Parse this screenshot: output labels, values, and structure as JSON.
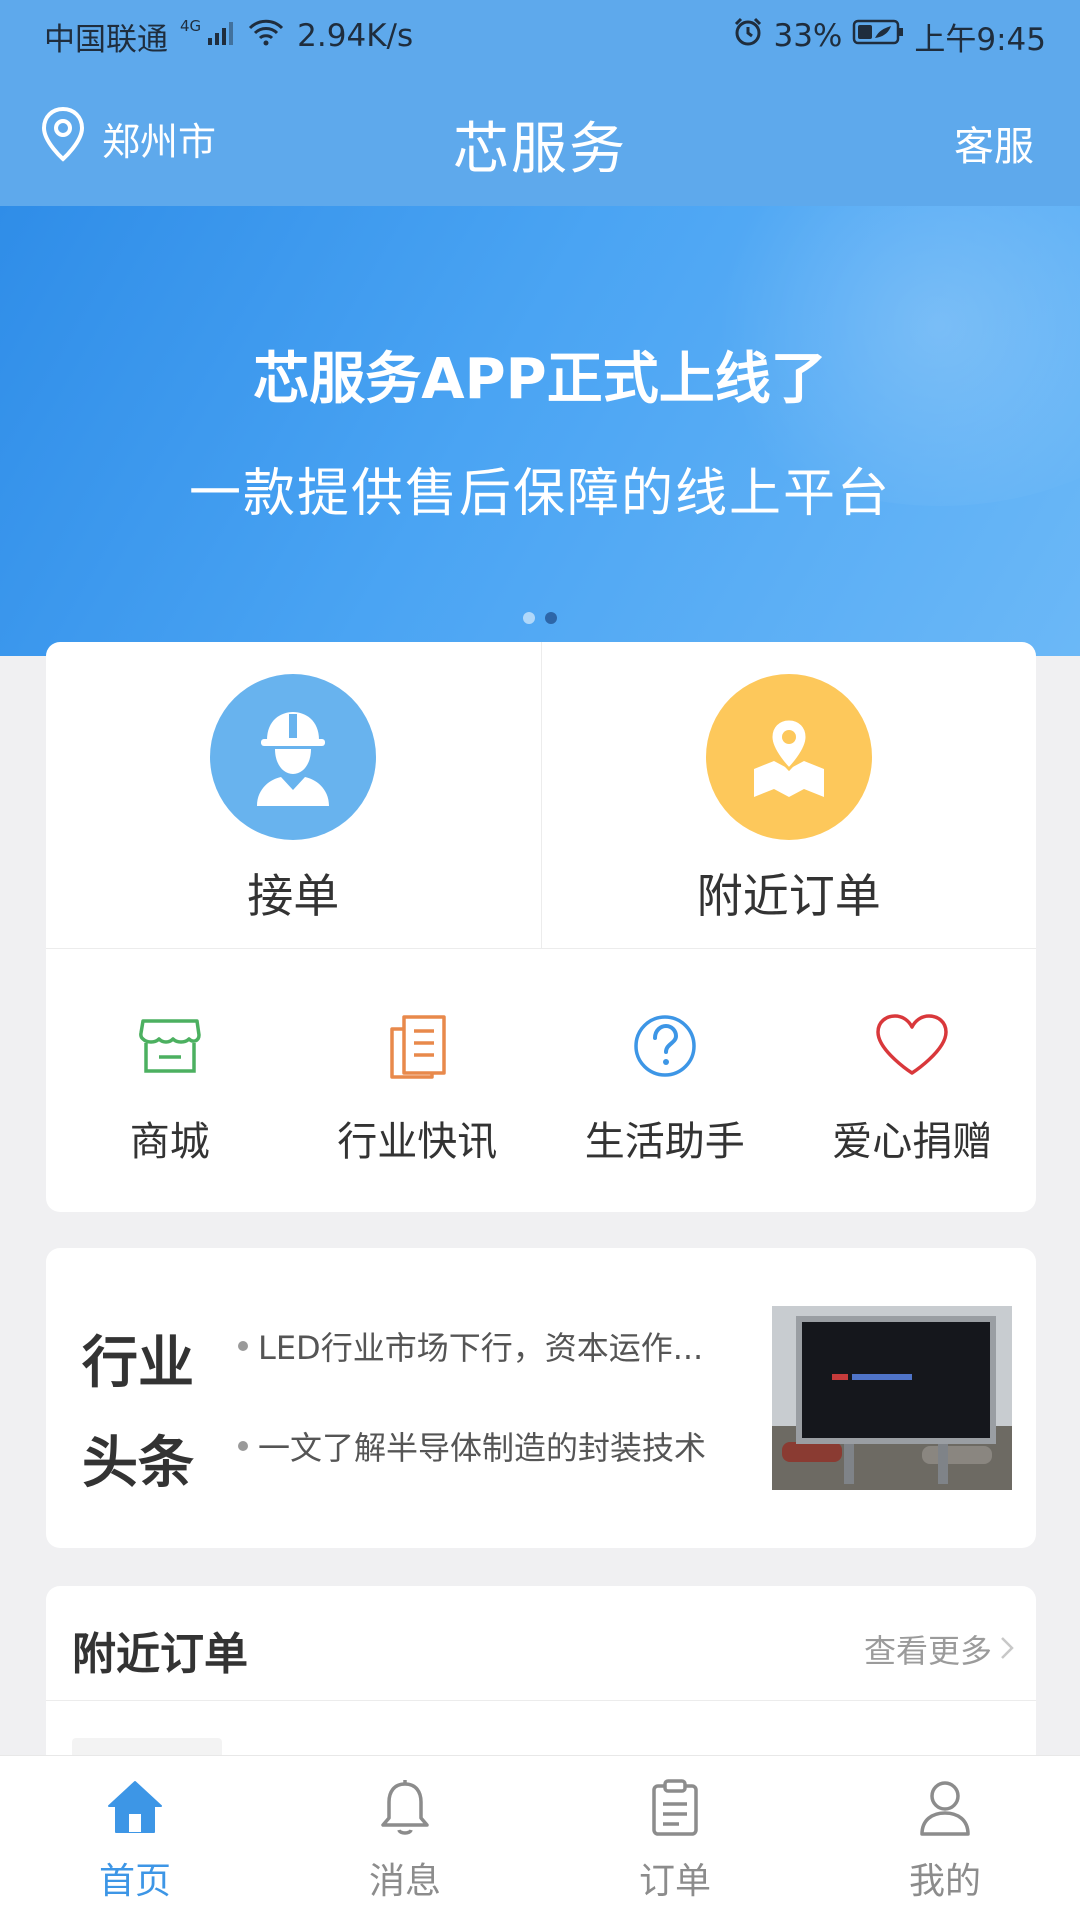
{
  "status_bar": {
    "carrier": "中国联通",
    "network_type": "4G",
    "network_speed": "2.94K/s",
    "battery": "33%",
    "time": "上午9:45",
    "icons": [
      "signal-icon",
      "wifi-icon",
      "alarm-icon",
      "battery-icon"
    ]
  },
  "header": {
    "location": "郑州市",
    "title": "芯服务",
    "service": "客服"
  },
  "banner": {
    "title": "芯服务APP正式上线了",
    "subtitle": "一款提供售后保障的线上平台",
    "page_count": 2,
    "active_page": 2
  },
  "actions": {
    "primary": [
      {
        "label": "接单",
        "icon": "worker-icon",
        "color": "#68b3ee"
      },
      {
        "label": "附近订单",
        "icon": "map-pin-icon",
        "color": "#fdc85b"
      }
    ],
    "secondary": [
      {
        "label": "商城",
        "icon": "store-icon",
        "color": "#4cb060"
      },
      {
        "label": "行业快讯",
        "icon": "news-icon",
        "color": "#e8894b"
      },
      {
        "label": "生活助手",
        "icon": "help-icon",
        "color": "#3d96e6"
      },
      {
        "label": "爱心捐赠",
        "icon": "heart-icon",
        "color": "#d9383b"
      }
    ]
  },
  "headlines": {
    "badge_line1": "行业",
    "badge_line2": "头条",
    "items": [
      "LED行业市场下行，资本运作...",
      "一文了解半导体制造的封装技术"
    ]
  },
  "nearby_orders": {
    "title": "附近订单",
    "more": "查看更多"
  },
  "bottom_nav": {
    "items": [
      {
        "label": "首页",
        "icon": "home-icon",
        "active": true
      },
      {
        "label": "消息",
        "icon": "bell-icon",
        "active": false
      },
      {
        "label": "订单",
        "icon": "clipboard-icon",
        "active": false
      },
      {
        "label": "我的",
        "icon": "user-icon",
        "active": false
      }
    ]
  },
  "colors": {
    "primary": "#5ea9ec",
    "accent": "#3d96e6",
    "background": "#f0f0f2"
  }
}
